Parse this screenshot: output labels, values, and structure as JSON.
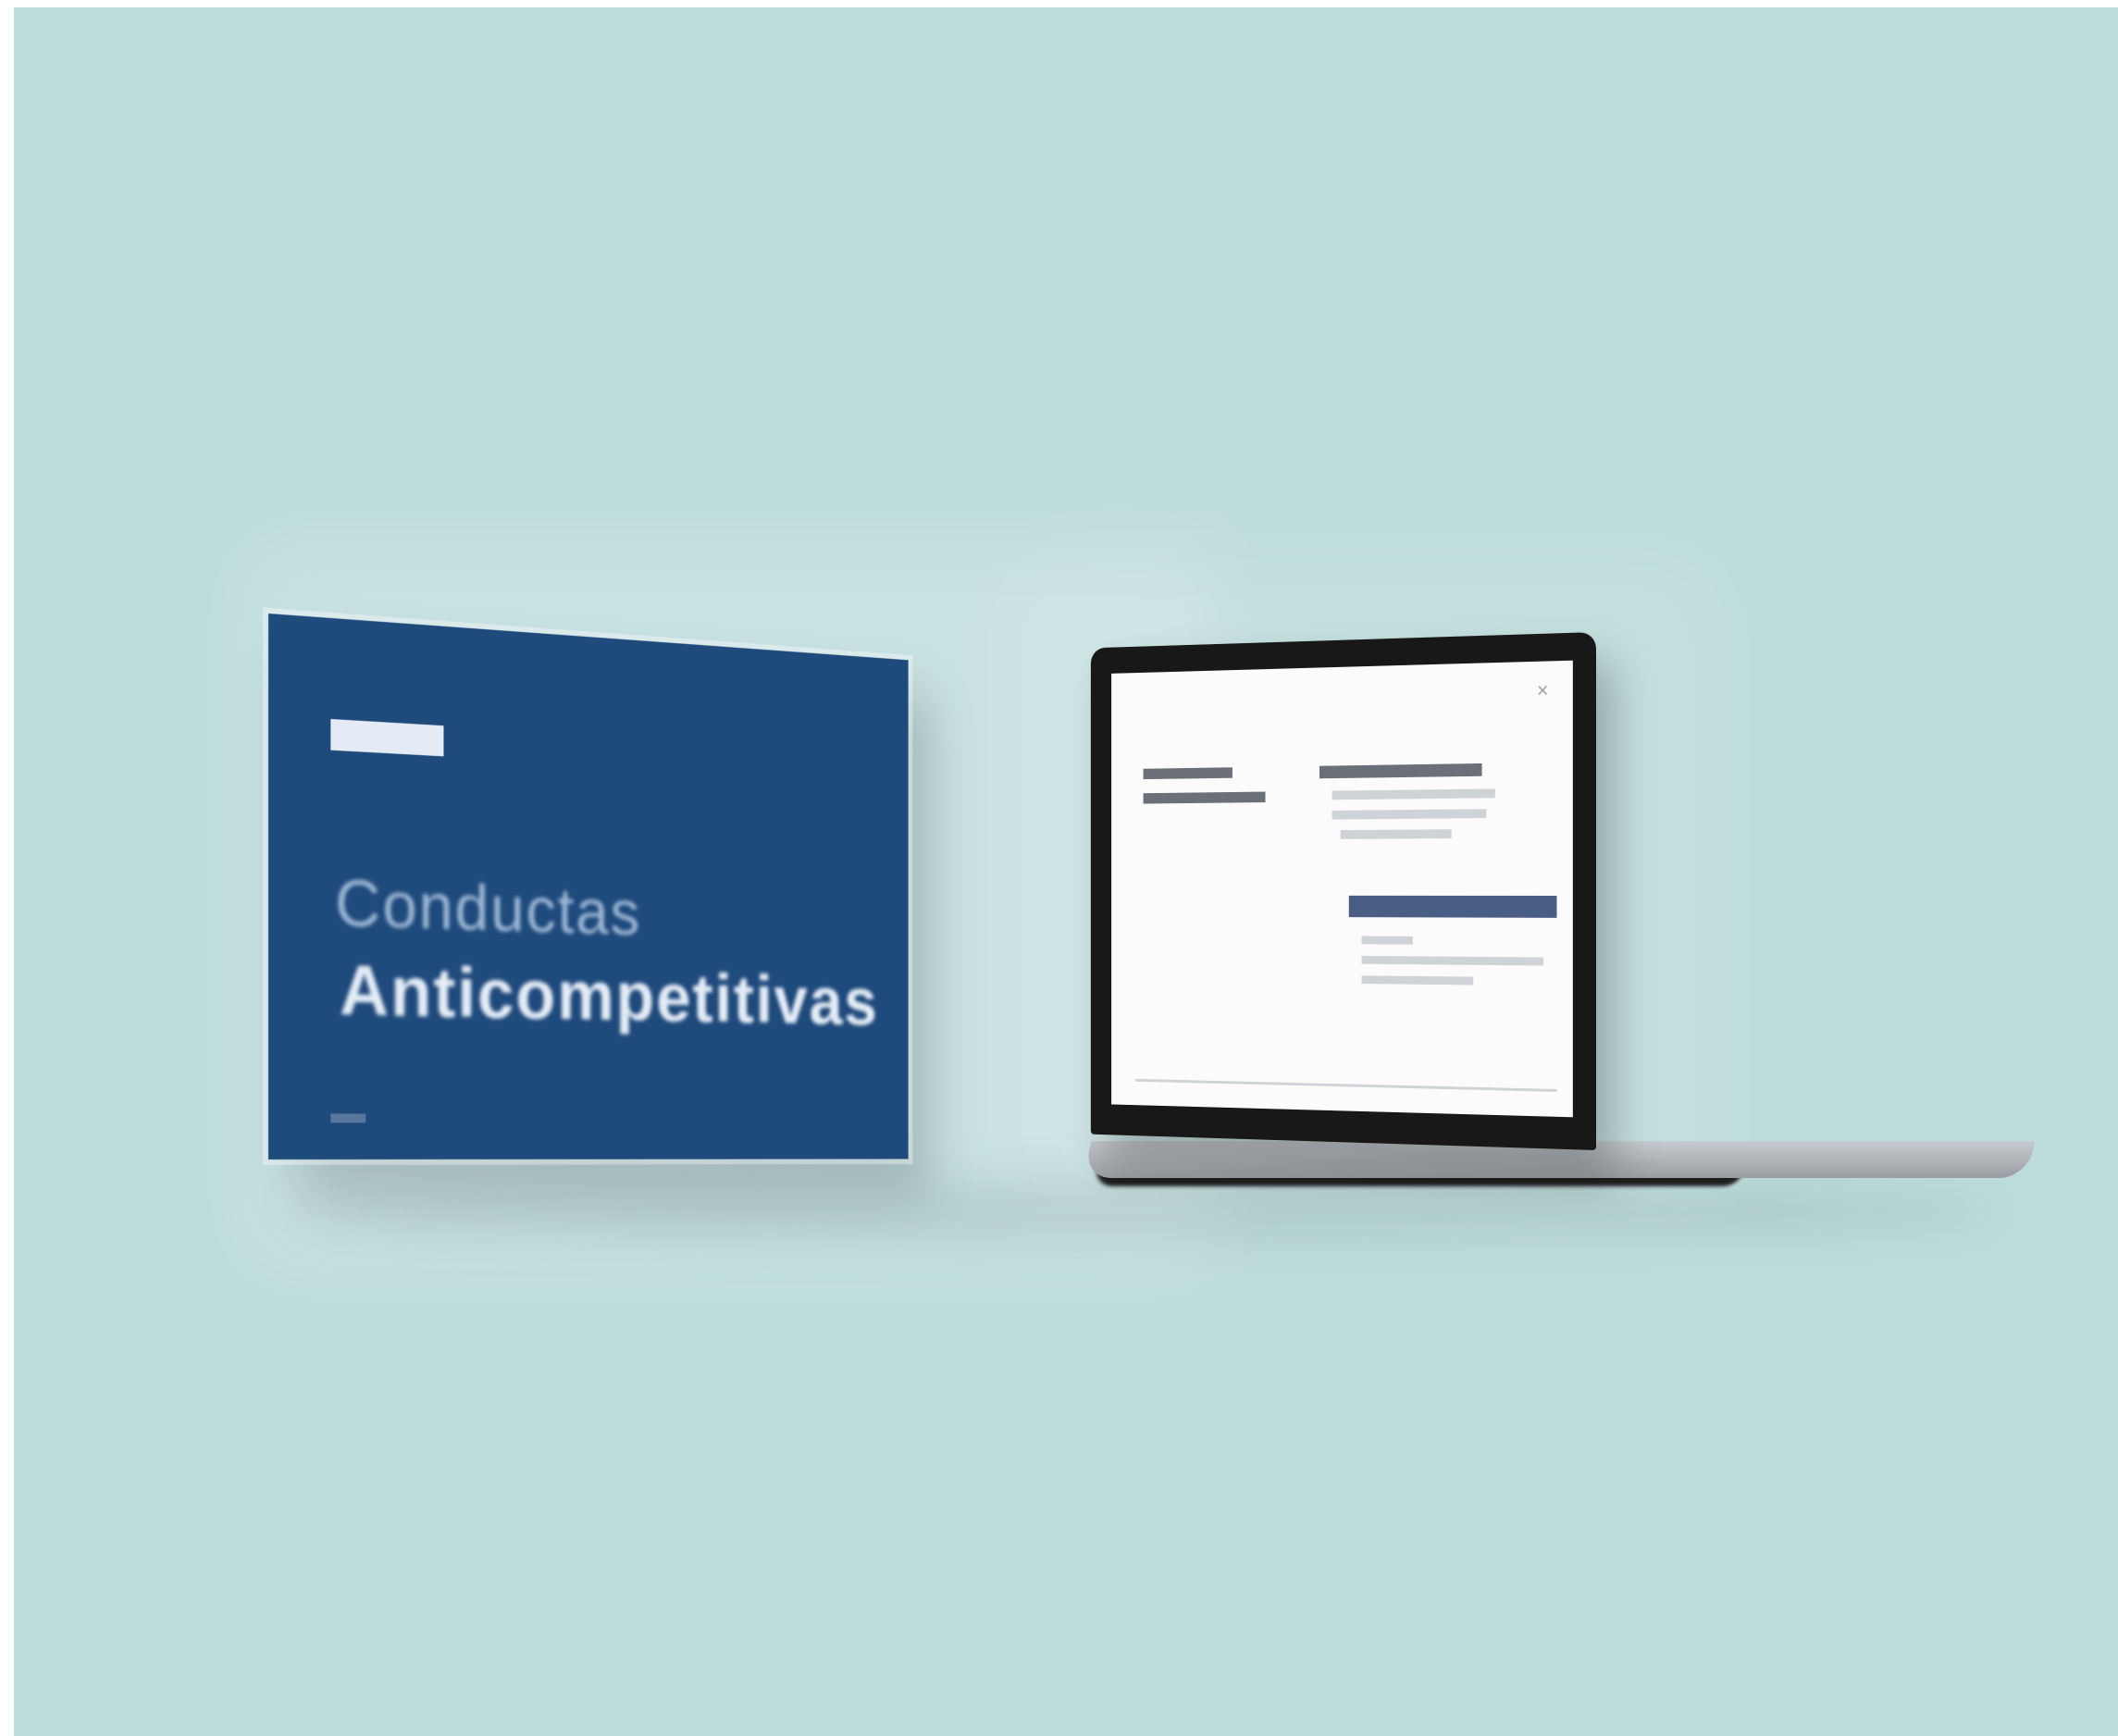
{
  "presentation": {
    "brand_label": "",
    "title_line_1": "Conductas",
    "title_line_2": "Anticompetitivas"
  },
  "laptop_screen": {
    "close_symbol": "×",
    "heading": ""
  },
  "colors": {
    "background": "#bedcdc",
    "card_blue": "#1f4a7c",
    "screen": "#fbfbfb",
    "laptop_frame": "#181818"
  },
  "icons": {
    "close": "close-icon"
  }
}
